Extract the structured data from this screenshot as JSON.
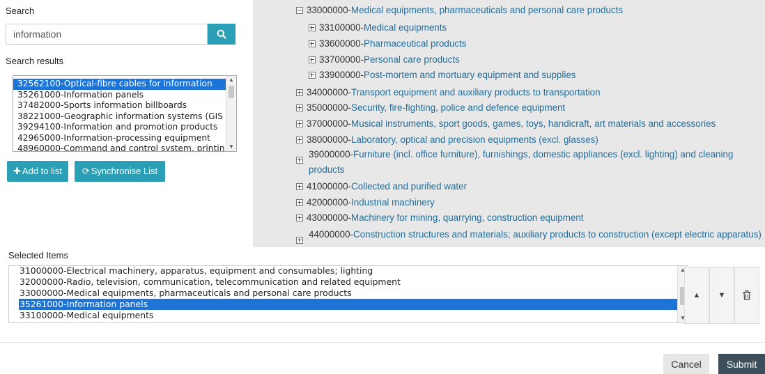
{
  "search": {
    "label": "Search",
    "value": "information",
    "results_label": "Search results",
    "results": [
      "32562100-Optical-fibre cables for information",
      "35261000-Information panels",
      "37482000-Sports information billboards",
      "38221000-Geographic information systems (GIS",
      "39294100-Information and promotion products",
      "42965000-Information-processing equipment",
      "48960000-Command and control system, printin"
    ],
    "selected_result_index": 0
  },
  "actions": {
    "add_to_list": "Add to list",
    "synchronise_list": "Synchronise List"
  },
  "tree": {
    "nodes": [
      {
        "code": "33000000-",
        "name": "Medical equipments, pharmaceuticals and personal care products",
        "state": "expanded"
      },
      {
        "code": "33100000-",
        "name": "Medical equipments",
        "state": "collapsed"
      },
      {
        "code": "33600000-",
        "name": "Pharmaceutical products",
        "state": "collapsed"
      },
      {
        "code": "33700000-",
        "name": "Personal care products",
        "state": "collapsed"
      },
      {
        "code": "33900000-",
        "name": "Post-mortem and mortuary equipment and supplies",
        "state": "collapsed"
      },
      {
        "code": "34000000-",
        "name": "Transport equipment and auxiliary products to transportation",
        "state": "collapsed"
      },
      {
        "code": "35000000-",
        "name": "Security, fire-fighting, police and defence equipment",
        "state": "collapsed"
      },
      {
        "code": "37000000-",
        "name": "Musical instruments, sport goods, games, toys, handicraft, art materials and accessories",
        "state": "collapsed"
      },
      {
        "code": "38000000-",
        "name": "Laboratory, optical and precision equipments (excl. glasses)",
        "state": "collapsed"
      },
      {
        "code": "39000000-",
        "name": "Furniture (incl. office furniture), furnishings, domestic appliances (excl. lighting) and cleaning products",
        "state": "collapsed"
      },
      {
        "code": "41000000-",
        "name": "Collected and purified water",
        "state": "collapsed"
      },
      {
        "code": "42000000-",
        "name": "Industrial machinery",
        "state": "collapsed"
      },
      {
        "code": "43000000-",
        "name": "Machinery for mining, quarrying, construction equipment",
        "state": "collapsed"
      },
      {
        "code": "44000000-",
        "name": "Construction structures and materials; auxiliary products to construction (except electric apparatus)",
        "state": "collapsed"
      }
    ]
  },
  "selected_items": {
    "label": "Selected Items",
    "items": [
      "31000000-Electrical machinery, apparatus, equipment and consumables; lighting",
      "32000000-Radio, television, communication, telecommunication and related equipment",
      "33000000-Medical equipments, pharmaceuticals and personal care products",
      "35261000-Information panels",
      "33100000-Medical equipments"
    ],
    "selected_index": 3
  },
  "footer": {
    "cancel": "Cancel",
    "submit": "Submit"
  },
  "colors": {
    "accent": "#2a9fb5",
    "selection": "#1e74d6",
    "link": "#1f6e9c",
    "submit": "#3d4f5c"
  }
}
